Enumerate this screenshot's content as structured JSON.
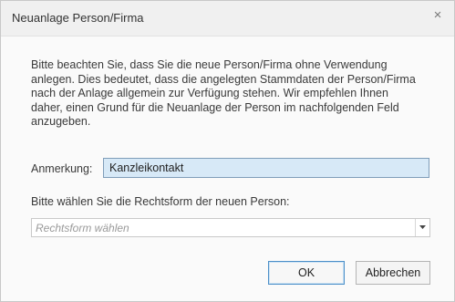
{
  "dialog": {
    "title": "Neuanlage Person/Firma",
    "close_symbol": "×",
    "close_icon": "close-icon"
  },
  "info": {
    "lines": [
      "Bitte beachten Sie, dass Sie die neue Person/Firma ohne Verwendung",
      "anlegen. Dies bedeutet, dass die angelegten Stammdaten der Person/Firma",
      "nach der Anlage allgemein zur Verfügung stehen. Wir empfehlen Ihnen",
      "daher, einen Grund für die Neuanlage der Person im nachfolgenden Feld",
      "anzugeben."
    ]
  },
  "anmerkung": {
    "label": "Anmerkung:",
    "value": "Kanzleikontakt"
  },
  "rechtsform": {
    "label": "Bitte wählen Sie die Rechtsform der neuen Person:",
    "placeholder": "Rechtsform wählen",
    "dropdown_icon": "triangle-down-icon"
  },
  "buttons": {
    "ok": "OK",
    "cancel": "Abbrechen"
  }
}
